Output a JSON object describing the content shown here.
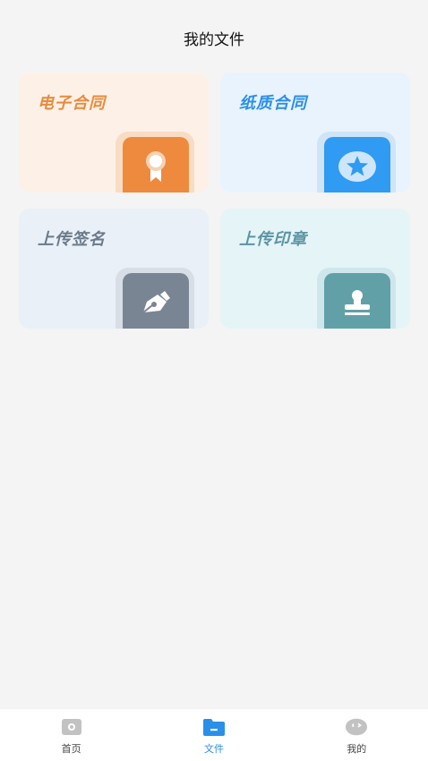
{
  "header": {
    "title": "我的文件"
  },
  "cards": {
    "econtract": {
      "label": "电子合同",
      "icon": "ribbon-award-icon",
      "color": "#ed8a3e"
    },
    "paper": {
      "label": "纸质合同",
      "icon": "star-badge-icon",
      "color": "#2f9bf2"
    },
    "signature": {
      "label": "上传签名",
      "icon": "pen-nib-icon",
      "color": "#7a8594"
    },
    "seal": {
      "label": "上传印章",
      "icon": "stamp-icon",
      "color": "#62a0a8"
    }
  },
  "tabbar": {
    "items": [
      {
        "label": "首页",
        "icon": "home-icon",
        "active": false
      },
      {
        "label": "文件",
        "icon": "folder-icon",
        "active": true
      },
      {
        "label": "我的",
        "icon": "profile-icon",
        "active": false
      }
    ],
    "active_color": "#2a8fe8"
  }
}
